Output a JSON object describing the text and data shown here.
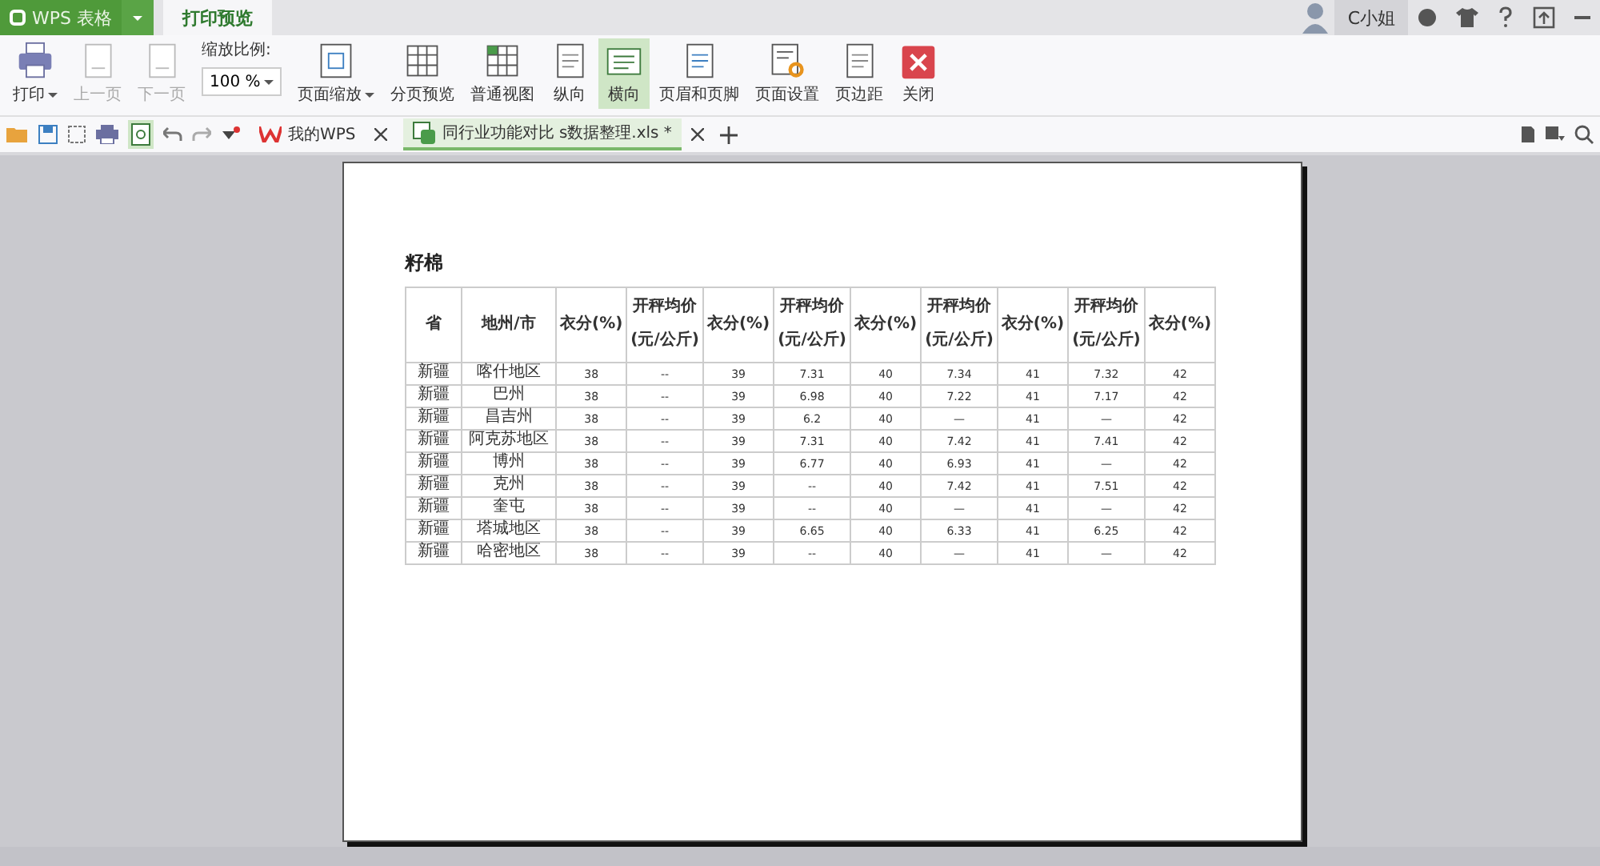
{
  "app_button": {
    "label": "WPS 表格"
  },
  "ribbon_tabs": [
    {
      "label": "打印预览",
      "selected": true
    }
  ],
  "user": {
    "name": "C小姐"
  },
  "ribbon": [
    {
      "kind": "button",
      "label": "打印",
      "dropdown": true,
      "disabled": false,
      "selected": false
    },
    {
      "kind": "button",
      "label": "上一页",
      "dropdown": false,
      "disabled": true,
      "selected": false
    },
    {
      "kind": "button",
      "label": "下一页",
      "dropdown": false,
      "disabled": true,
      "selected": false
    },
    {
      "kind": "zoom",
      "label": "缩放比例:",
      "value": "100 %"
    },
    {
      "kind": "button",
      "label": "页面缩放",
      "dropdown": true,
      "disabled": false,
      "selected": false
    },
    {
      "kind": "button",
      "label": "分页预览",
      "dropdown": false,
      "disabled": false,
      "selected": false
    },
    {
      "kind": "button",
      "label": "普通视图",
      "dropdown": false,
      "disabled": false,
      "selected": false
    },
    {
      "kind": "button",
      "label": "纵向",
      "dropdown": false,
      "disabled": false,
      "selected": false
    },
    {
      "kind": "button",
      "label": "横向",
      "dropdown": false,
      "disabled": false,
      "selected": true
    },
    {
      "kind": "button",
      "label": "页眉和页脚",
      "dropdown": false,
      "disabled": false,
      "selected": false
    },
    {
      "kind": "button",
      "label": "页面设置",
      "dropdown": false,
      "disabled": false,
      "selected": false
    },
    {
      "kind": "button",
      "label": "页边距",
      "dropdown": false,
      "disabled": false,
      "selected": false
    },
    {
      "kind": "button",
      "label": "关闭",
      "dropdown": false,
      "disabled": false,
      "selected": false
    }
  ],
  "doc_tabs": [
    {
      "label": "我的WPS",
      "selected": false
    },
    {
      "label": "同行业功能对比 s数据整理.xls *",
      "selected": true
    }
  ],
  "sheet": {
    "title": "籽棉",
    "columns": [
      "省",
      "地州/市",
      "衣分(%)",
      "开秤均价\n\n(元/公斤)",
      "衣分(%)",
      "开秤均价\n\n(元/公斤)",
      "衣分(%)",
      "开秤均价\n\n(元/公斤)",
      "衣分(%)",
      "开秤均价\n\n(元/公斤)",
      "衣分(%)"
    ],
    "rows": [
      [
        "新疆",
        "喀什地区",
        "38",
        "--",
        "39",
        "7.31",
        "40",
        "7.34",
        "41",
        "7.32",
        "42"
      ],
      [
        "新疆",
        "巴州",
        "38",
        "--",
        "39",
        "6.98",
        "40",
        "7.22",
        "41",
        "7.17",
        "42"
      ],
      [
        "新疆",
        "昌吉州",
        "38",
        "--",
        "39",
        "6.2",
        "40",
        "—",
        "41",
        "—",
        "42"
      ],
      [
        "新疆",
        "阿克苏地区",
        "38",
        "--",
        "39",
        "7.31",
        "40",
        "7.42",
        "41",
        "7.41",
        "42"
      ],
      [
        "新疆",
        "博州",
        "38",
        "--",
        "39",
        "6.77",
        "40",
        "6.93",
        "41",
        "—",
        "42"
      ],
      [
        "新疆",
        "克州",
        "38",
        "--",
        "39",
        "--",
        "40",
        "7.42",
        "41",
        "7.51",
        "42"
      ],
      [
        "新疆",
        "奎屯",
        "38",
        "--",
        "39",
        "--",
        "40",
        "—",
        "41",
        "—",
        "42"
      ],
      [
        "新疆",
        "塔城地区",
        "38",
        "--",
        "39",
        "6.65",
        "40",
        "6.33",
        "41",
        "6.25",
        "42"
      ],
      [
        "新疆",
        "哈密地区",
        "38",
        "--",
        "39",
        "--",
        "40",
        "—",
        "41",
        "—",
        "42"
      ]
    ]
  }
}
